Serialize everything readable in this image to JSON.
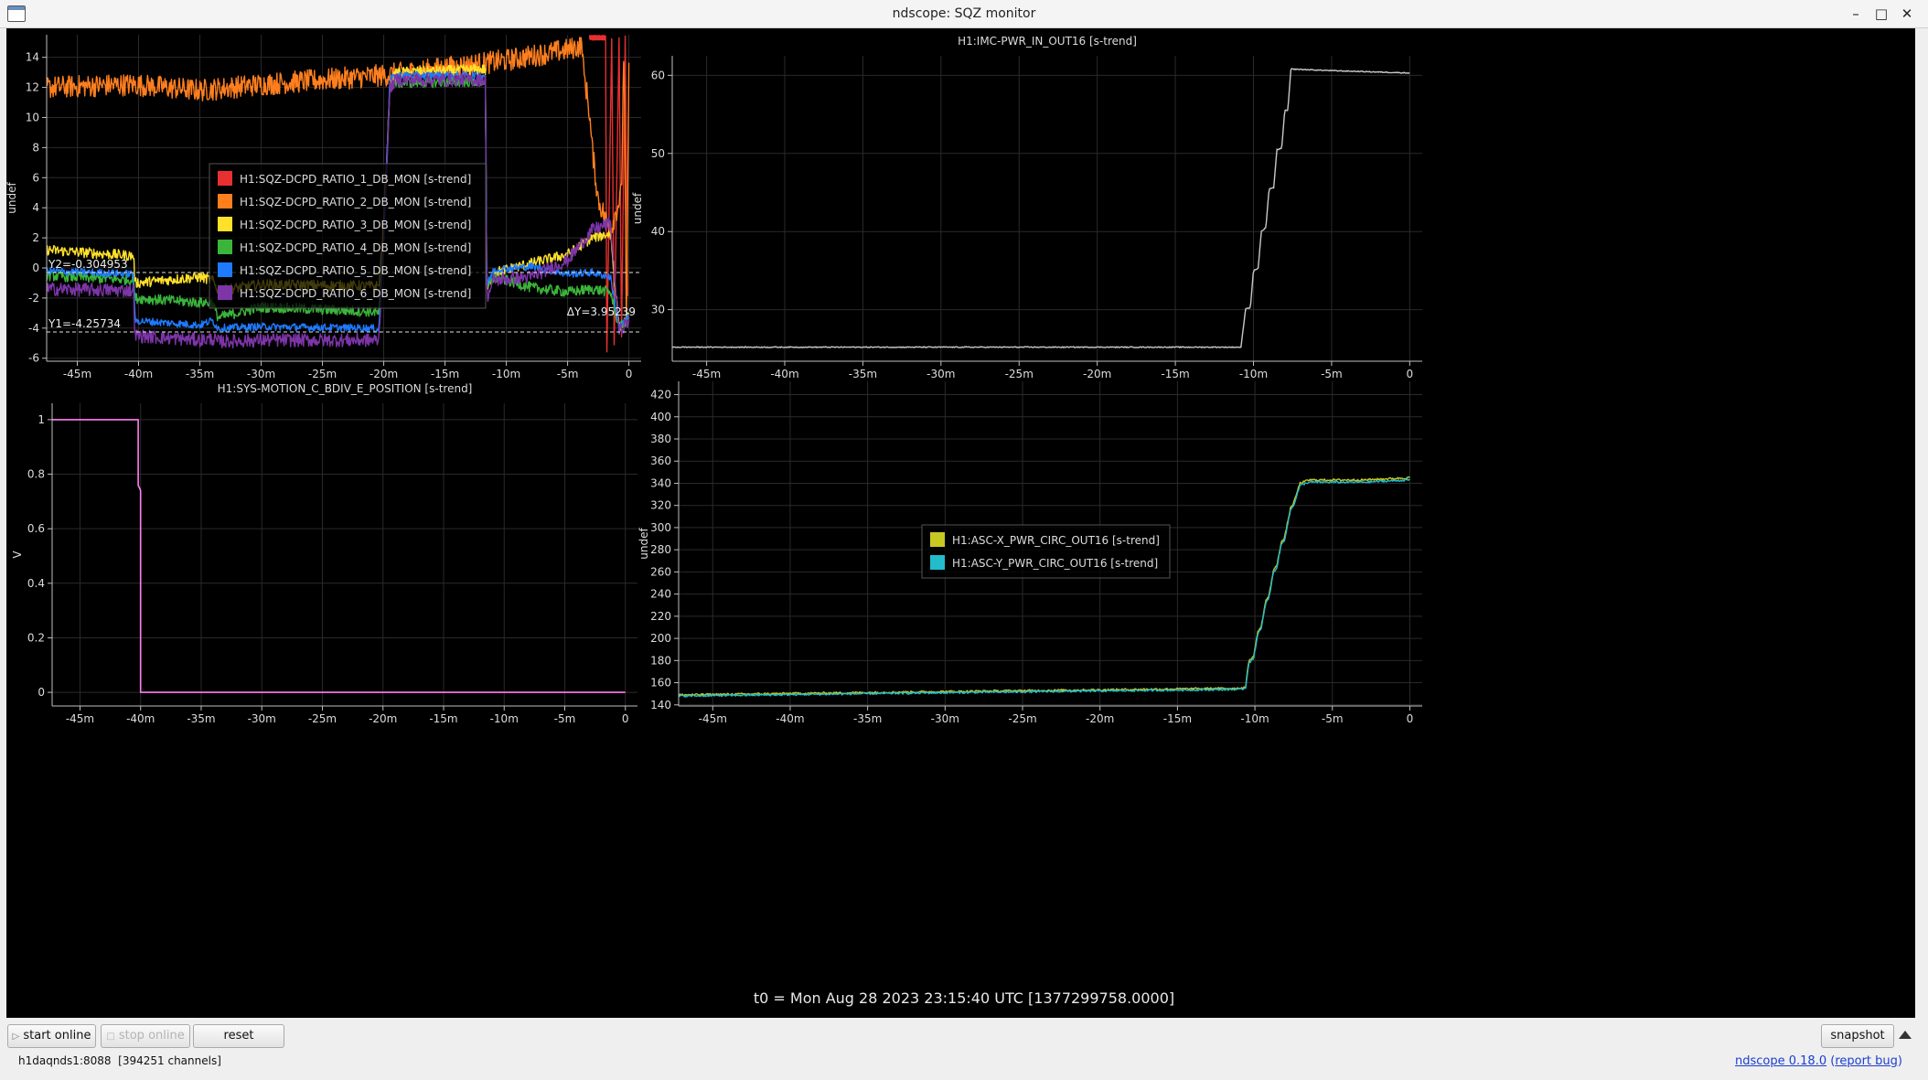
{
  "window": {
    "title": "ndscope: SQZ monitor",
    "min_glyph": "–",
    "max_glyph": "□",
    "close_glyph": "✕"
  },
  "time_label": "t0 = Mon Aug 28 2023 23:15:40 UTC [1377299758.0000]",
  "toolbar": {
    "start_online": "start online",
    "stop_online": "stop online",
    "reset": "reset",
    "snapshot": "snapshot",
    "server": "h1daqnds1:8088",
    "channels": "[394251 channels]",
    "version_link": "ndscope 0.18.0",
    "report_open": " (",
    "report_link": "report bug",
    "report_close": ")"
  },
  "colors": {
    "background": "#000000",
    "grid": "#2a2a2a",
    "axis": "#bfbfbf",
    "text": "#dcdcdc"
  },
  "chart_data": [
    {
      "type": "line",
      "title": "",
      "ylabel": "undef",
      "xlim": [
        -47.5,
        1
      ],
      "ylim": [
        -6.2,
        15.5
      ],
      "xticks": [
        -45,
        -40,
        -35,
        -30,
        -25,
        -20,
        -15,
        -10,
        -5,
        0
      ],
      "xticklabels": [
        "-45m",
        "-40m",
        "-35m",
        "-30m",
        "-25m",
        "-20m",
        "-15m",
        "-10m",
        "-5m",
        "0"
      ],
      "yticks": [
        -6,
        -4,
        -2,
        0,
        2,
        4,
        6,
        8,
        10,
        12,
        14
      ],
      "grid": true,
      "legend_position": "left",
      "series": [
        {
          "name": "H1:SQZ-DCPD_RATIO_1_DB_MON [s-trend]",
          "color": "#e83030",
          "noise": 0.15,
          "points": [
            [
              -3.2,
              15.3
            ],
            [
              -1.9,
              15.3
            ],
            [
              -1.8,
              -5.8
            ],
            [
              -1.4,
              15.3
            ],
            [
              -1.2,
              -5.2
            ],
            [
              -0.8,
              15.3
            ],
            [
              -0.6,
              -4.5
            ],
            [
              -0.3,
              15.3
            ],
            [
              -0.1,
              -2.0
            ]
          ]
        },
        {
          "name": "H1:SQZ-DCPD_RATIO_2_DB_MON [s-trend]",
          "color": "#ff7f1e",
          "noise": 0.75,
          "points": [
            [
              -47.5,
              12.0
            ],
            [
              -40.5,
              12.2
            ],
            [
              -35,
              11.8
            ],
            [
              -30,
              12.2
            ],
            [
              -25,
              12.5
            ],
            [
              -20,
              12.8
            ],
            [
              -15,
              13.3
            ],
            [
              -10,
              13.8
            ],
            [
              -5,
              14.5
            ],
            [
              -3.8,
              14.8
            ],
            [
              -3.7,
              13.0
            ],
            [
              -3.3,
              11.0
            ],
            [
              -3.0,
              8.0
            ],
            [
              -2.5,
              4.5
            ],
            [
              -1.5,
              2.5
            ],
            [
              -0.6,
              5.0
            ],
            [
              -0.4,
              15.3
            ],
            [
              -0.2,
              -5.0
            ],
            [
              0,
              14.0
            ]
          ]
        },
        {
          "name": "H1:SQZ-DCPD_RATIO_3_DB_MON [s-trend]",
          "color": "#ffe12a",
          "noise": 0.35,
          "points": [
            [
              -47.5,
              1.2
            ],
            [
              -40.4,
              0.8
            ],
            [
              -40.3,
              -1.0
            ],
            [
              -35,
              -0.6
            ],
            [
              -34,
              -0.8
            ],
            [
              -33.5,
              -1.5
            ],
            [
              -30,
              -1.1
            ],
            [
              -21,
              -1.2
            ],
            [
              -20.4,
              -1.2
            ],
            [
              -20,
              3.0
            ],
            [
              -19.5,
              12.0
            ],
            [
              -19,
              13.0
            ],
            [
              -12,
              13.2
            ],
            [
              -11.7,
              13.2
            ],
            [
              -11.6,
              -1.5
            ],
            [
              -11,
              -0.3
            ],
            [
              -8,
              0.3
            ],
            [
              -5,
              0.9
            ],
            [
              -3,
              2.0
            ],
            [
              -1.5,
              2.3
            ],
            [
              -0.8,
              -4.0
            ],
            [
              0,
              -3.3
            ]
          ]
        },
        {
          "name": "H1:SQZ-DCPD_RATIO_4_DB_MON [s-trend]",
          "color": "#3ab53a",
          "noise": 0.35,
          "points": [
            [
              -47.5,
              -0.5
            ],
            [
              -40.4,
              -0.8
            ],
            [
              -40.3,
              -2.0
            ],
            [
              -35,
              -2.3
            ],
            [
              -34,
              -2.3
            ],
            [
              -33.5,
              -3.3
            ],
            [
              -30,
              -2.6
            ],
            [
              -21,
              -2.9
            ],
            [
              -20.4,
              -3.0
            ],
            [
              -20,
              2.0
            ],
            [
              -19.5,
              12.0
            ],
            [
              -19,
              12.3
            ],
            [
              -12,
              12.4
            ],
            [
              -11.7,
              12.4
            ],
            [
              -11.6,
              -1.5
            ],
            [
              -11,
              -0.6
            ],
            [
              -8,
              -1.3
            ],
            [
              -5,
              -1.6
            ],
            [
              -3,
              -1.4
            ],
            [
              -1.5,
              -1.6
            ],
            [
              -0.8,
              -4.0
            ],
            [
              0,
              -3.3
            ]
          ]
        },
        {
          "name": "H1:SQZ-DCPD_RATIO_5_DB_MON [s-trend]",
          "color": "#1e7bff",
          "noise": 0.25,
          "points": [
            [
              -47.5,
              -0.2
            ],
            [
              -40.4,
              -0.4
            ],
            [
              -40.3,
              -3.5
            ],
            [
              -35,
              -3.8
            ],
            [
              -34,
              -3.5
            ],
            [
              -33.5,
              -4.0
            ],
            [
              -30,
              -3.9
            ],
            [
              -21,
              -4.0
            ],
            [
              -20.4,
              -4.1
            ],
            [
              -20,
              2.0
            ],
            [
              -19.5,
              12.5
            ],
            [
              -19,
              12.8
            ],
            [
              -12,
              12.8
            ],
            [
              -11.7,
              12.8
            ],
            [
              -11.6,
              -1.2
            ],
            [
              -11,
              -0.1
            ],
            [
              -8,
              0.1
            ],
            [
              -5,
              -0.4
            ],
            [
              -3,
              -0.3
            ],
            [
              -1.5,
              -0.6
            ],
            [
              -0.8,
              -4.0
            ],
            [
              0,
              -3.2
            ]
          ]
        },
        {
          "name": "H1:SQZ-DCPD_RATIO_6_DB_MON [s-trend]",
          "color": "#7d35a8",
          "noise": 0.45,
          "points": [
            [
              -47.5,
              -1.4
            ],
            [
              -40.4,
              -1.5
            ],
            [
              -40.3,
              -4.5
            ],
            [
              -35,
              -4.8
            ],
            [
              -34,
              -4.7
            ],
            [
              -33.5,
              -4.9
            ],
            [
              -30,
              -4.8
            ],
            [
              -21,
              -4.8
            ],
            [
              -20.4,
              -4.8
            ],
            [
              -20,
              2.0
            ],
            [
              -19.5,
              12.0
            ],
            [
              -19,
              12.5
            ],
            [
              -12,
              12.5
            ],
            [
              -11.7,
              12.5
            ],
            [
              -11.6,
              -2.0
            ],
            [
              -11,
              -0.8
            ],
            [
              -8,
              -0.6
            ],
            [
              -5,
              0.5
            ],
            [
              -3,
              2.5
            ],
            [
              -1.5,
              3.0
            ],
            [
              -0.8,
              -4.2
            ],
            [
              0,
              -3.5
            ]
          ]
        }
      ],
      "cursors": {
        "y1": -4.25734,
        "y2": -0.304953,
        "y1_label": "Y1=-4.25734",
        "y2_label": "Y2=-0.304953",
        "dy_label": "ΔY=3.95239"
      }
    },
    {
      "type": "line",
      "title": "H1:IMC-PWR_IN_OUT16 [s-trend]",
      "ylabel": "undef",
      "xlim": [
        -47.2,
        0.8
      ],
      "ylim": [
        23.4,
        62.5
      ],
      "xticks": [
        -45,
        -40,
        -35,
        -30,
        -25,
        -20,
        -15,
        -10,
        -5,
        0
      ],
      "xticklabels": [
        "-45m",
        "-40m",
        "-35m",
        "-30m",
        "-25m",
        "-20m",
        "-15m",
        "-10m",
        "-5m",
        "0"
      ],
      "yticks": [
        30,
        40,
        50,
        60
      ],
      "grid": true,
      "series": [
        {
          "name": "H1:IMC-PWR_IN_OUT16 [s-trend]",
          "color": "#c8c8c8",
          "noise": 0.06,
          "points": [
            [
              -47.2,
              25.2
            ],
            [
              -10.8,
              25.2
            ],
            [
              -10.5,
              30.2
            ],
            [
              -10.2,
              30.2
            ],
            [
              -10.0,
              35.0
            ],
            [
              -9.7,
              35.3
            ],
            [
              -9.5,
              40.0
            ],
            [
              -9.2,
              40.5
            ],
            [
              -9.0,
              45.5
            ],
            [
              -8.7,
              45.6
            ],
            [
              -8.5,
              50.5
            ],
            [
              -8.2,
              50.6
            ],
            [
              -8.0,
              55.5
            ],
            [
              -7.8,
              55.5
            ],
            [
              -7.6,
              60.8
            ],
            [
              -5,
              60.6
            ],
            [
              0,
              60.3
            ]
          ]
        }
      ]
    },
    {
      "type": "line",
      "title": "H1:SYS-MOTION_C_BDIV_E_POSITION [s-trend]",
      "ylabel": "V",
      "xlim": [
        -47.3,
        1
      ],
      "ylim": [
        -0.05,
        1.06
      ],
      "xticks": [
        -45,
        -40,
        -35,
        -30,
        -25,
        -20,
        -15,
        -10,
        -5,
        0
      ],
      "xticklabels": [
        "-45m",
        "-40m",
        "-35m",
        "-30m",
        "-25m",
        "-20m",
        "-15m",
        "-10m",
        "-5m",
        "0"
      ],
      "yticks": [
        0,
        0.2,
        0.4,
        0.6,
        0.8,
        1
      ],
      "yticklabels": [
        "0",
        "0.2",
        "0.4",
        "0.6",
        "0.8",
        "1"
      ],
      "grid": true,
      "series": [
        {
          "name": "H1:SYS-MOTION_C_BDIV_E_POSITION [s-trend]",
          "color": "#ff7ff0",
          "noise": 0,
          "points": [
            [
              -47.3,
              1
            ],
            [
              -40.2,
              1
            ],
            [
              -40.2,
              0.76
            ],
            [
              -40.0,
              0.74
            ],
            [
              -40.0,
              0
            ],
            [
              0,
              0
            ]
          ]
        }
      ]
    },
    {
      "type": "line",
      "title": "",
      "ylabel": "undef",
      "xlim": [
        -47.2,
        0.8
      ],
      "ylim": [
        139,
        432
      ],
      "xticks": [
        -45,
        -40,
        -35,
        -30,
        -25,
        -20,
        -15,
        -10,
        -5,
        0
      ],
      "xticklabels": [
        "-45m",
        "-40m",
        "-35m",
        "-30m",
        "-25m",
        "-20m",
        "-15m",
        "-10m",
        "-5m",
        "0"
      ],
      "yticks": [
        140,
        160,
        180,
        200,
        220,
        240,
        260,
        280,
        300,
        320,
        340,
        360,
        380,
        400,
        420
      ],
      "grid": true,
      "legend_position": "top-left",
      "series": [
        {
          "name": "H1:ASC-X_PWR_CIRC_OUT16 [s-trend]",
          "color": "#c8c822",
          "noise": 0.9,
          "points": [
            [
              -47.2,
              149
            ],
            [
              -30,
              152
            ],
            [
              -11,
              155
            ],
            [
              -10.6,
              156
            ],
            [
              -10.4,
              180
            ],
            [
              -10.1,
              183
            ],
            [
              -9.8,
              207
            ],
            [
              -9.6,
              210
            ],
            [
              -9.3,
              234
            ],
            [
              -9.1,
              238
            ],
            [
              -8.8,
              262
            ],
            [
              -8.6,
              265
            ],
            [
              -8.3,
              287
            ],
            [
              -8.1,
              290
            ],
            [
              -7.7,
              318
            ],
            [
              -7.5,
              322
            ],
            [
              -7.1,
              340
            ],
            [
              -6.5,
              343
            ],
            [
              -3,
              343
            ],
            [
              0,
              345
            ]
          ]
        },
        {
          "name": "H1:ASC-Y_PWR_CIRC_OUT16 [s-trend]",
          "color": "#22bccb",
          "noise": 0.9,
          "points": [
            [
              -47.2,
              148
            ],
            [
              -30,
              151
            ],
            [
              -11,
              154
            ],
            [
              -10.6,
              155
            ],
            [
              -10.4,
              178
            ],
            [
              -10.1,
              181
            ],
            [
              -9.8,
              205
            ],
            [
              -9.6,
              208
            ],
            [
              -9.3,
              232
            ],
            [
              -9.1,
              236
            ],
            [
              -8.8,
              260
            ],
            [
              -8.6,
              263
            ],
            [
              -8.3,
              285
            ],
            [
              -8.1,
              288
            ],
            [
              -7.7,
              316
            ],
            [
              -7.5,
              320
            ],
            [
              -7.1,
              338
            ],
            [
              -6.5,
              341
            ],
            [
              -3,
              341
            ],
            [
              0,
              343
            ]
          ]
        }
      ]
    }
  ]
}
